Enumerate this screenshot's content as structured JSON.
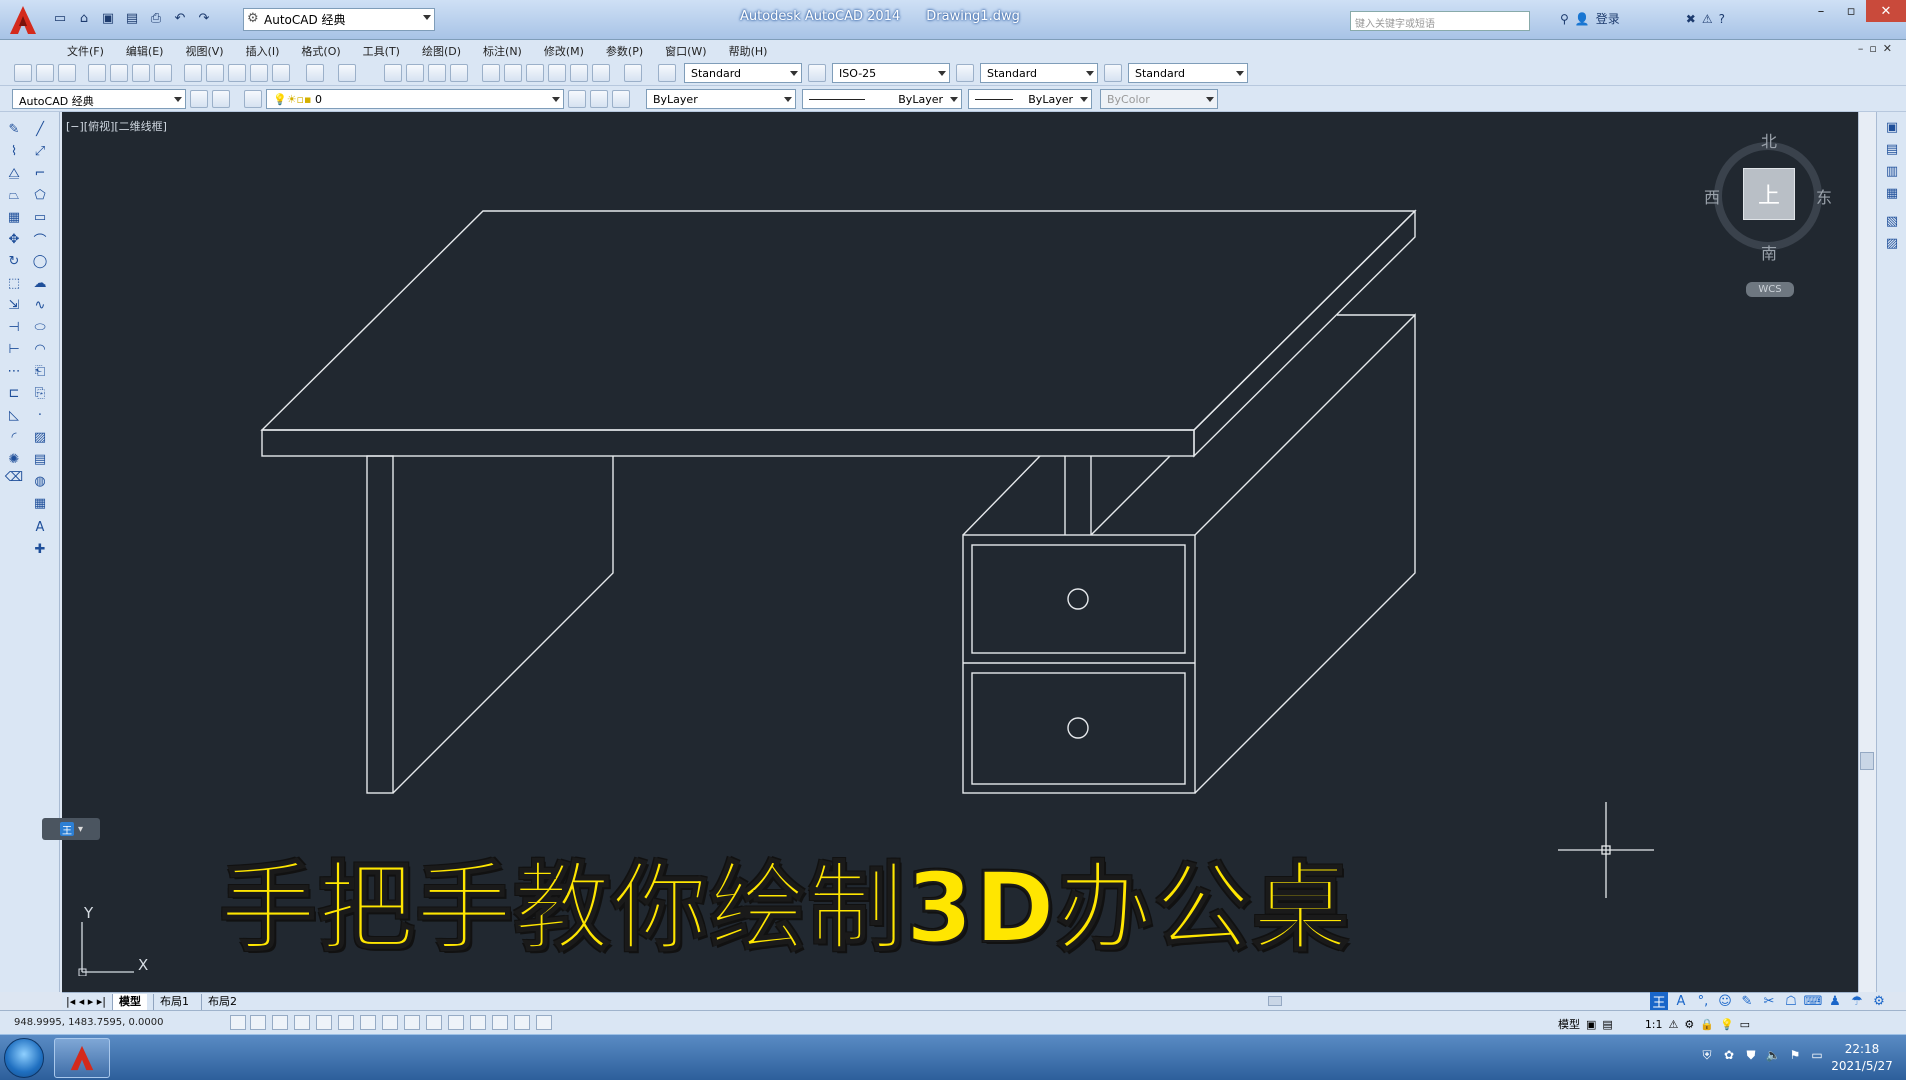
{
  "titlebar": {
    "app_name": "Autodesk AutoCAD 2014",
    "document": "Drawing1.dwg",
    "workspace": "AutoCAD 经典",
    "search_placeholder": "键入关键字或短语",
    "login": "登录"
  },
  "menu": [
    "文件(F)",
    "编辑(E)",
    "视图(V)",
    "插入(I)",
    "格式(O)",
    "工具(T)",
    "绘图(D)",
    "标注(N)",
    "修改(M)",
    "参数(P)",
    "窗口(W)",
    "帮助(H)"
  ],
  "styles": {
    "text_style": "Standard",
    "dim_style": "ISO-25",
    "table_style": "Standard",
    "mleader_style": "Standard"
  },
  "layers": {
    "workspace2": "AutoCAD 经典",
    "layer": "0",
    "color": "ByLayer",
    "linetype": "ByLayer",
    "lineweight": "ByLayer",
    "plotstyle": "ByColor"
  },
  "viewport": {
    "label": "[−][俯视][二维线框]"
  },
  "viewcube": {
    "north": "北",
    "south": "南",
    "west": "西",
    "east": "东",
    "top_face": "上",
    "wcs": "WCS"
  },
  "ucs": {
    "x": "X",
    "y": "Y"
  },
  "caption": "手把手教你绘制3D办公桌",
  "tabs": [
    "模型",
    "布局1",
    "布局2"
  ],
  "status": {
    "coordinates": "948.9995, 1483.7595, 0.0000",
    "model_label": "模型",
    "scale": "1:1"
  },
  "taskbar": {
    "time": "22:18",
    "date": "2021/5/27"
  },
  "colors": {
    "canvas": "#212830",
    "linework": "#e6e9ec",
    "caption": "#ffe600",
    "accent": "#d42a1c"
  }
}
